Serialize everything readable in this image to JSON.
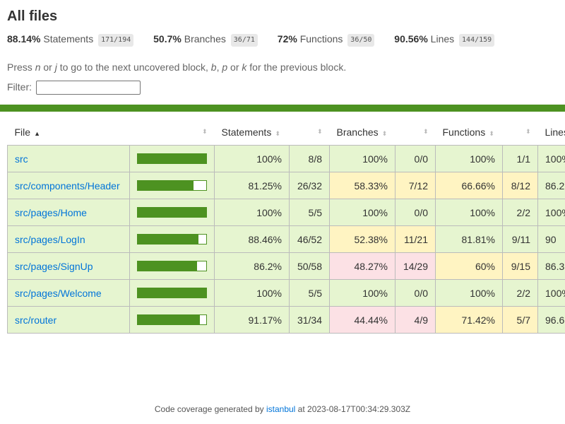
{
  "page": {
    "title": "All files",
    "instructions": {
      "prefix": "Press ",
      "key1": "n",
      "or1": " or ",
      "key2": "j",
      "mid": " to go to the next uncovered block, ",
      "key3": "b",
      "comma": ", ",
      "key4": "p",
      "or2": " or ",
      "key5": "k",
      "suffix": " for the previous block."
    },
    "filter_label": "Filter:",
    "filter_value": ""
  },
  "summary": {
    "statements": {
      "pct": "88.14%",
      "label": "Statements",
      "fraction": "171/194"
    },
    "branches": {
      "pct": "50.7%",
      "label": "Branches",
      "fraction": "36/71"
    },
    "functions": {
      "pct": "72%",
      "label": "Functions",
      "fraction": "36/50"
    },
    "lines": {
      "pct": "90.56%",
      "label": "Lines",
      "fraction": "144/159"
    }
  },
  "table": {
    "headers": {
      "file": "File",
      "statements": "Statements",
      "branches": "Branches",
      "functions": "Functions",
      "lines": "Lines"
    },
    "rows": [
      {
        "file": "src",
        "bar": 1.0,
        "st_pct": "100%",
        "st_frac": "8/8",
        "st_class": "high",
        "br_pct": "100%",
        "br_frac": "0/0",
        "br_class": "high",
        "fn_pct": "100%",
        "fn_frac": "1/1",
        "fn_class": "high",
        "ln_pct": "100%",
        "ln_class": "high"
      },
      {
        "file": "src/components/Header",
        "bar": 0.8125,
        "st_pct": "81.25%",
        "st_frac": "26/32",
        "st_class": "high",
        "br_pct": "58.33%",
        "br_frac": "7/12",
        "br_class": "medium",
        "fn_pct": "66.66%",
        "fn_frac": "8/12",
        "fn_class": "medium",
        "ln_pct": "86.2",
        "ln_class": "high"
      },
      {
        "file": "src/pages/Home",
        "bar": 1.0,
        "st_pct": "100%",
        "st_frac": "5/5",
        "st_class": "high",
        "br_pct": "100%",
        "br_frac": "0/0",
        "br_class": "high",
        "fn_pct": "100%",
        "fn_frac": "2/2",
        "fn_class": "high",
        "ln_pct": "100%",
        "ln_class": "high"
      },
      {
        "file": "src/pages/LogIn",
        "bar": 0.8846,
        "st_pct": "88.46%",
        "st_frac": "46/52",
        "st_class": "high",
        "br_pct": "52.38%",
        "br_frac": "11/21",
        "br_class": "medium",
        "fn_pct": "81.81%",
        "fn_frac": "9/11",
        "fn_class": "high",
        "ln_pct": "90",
        "ln_class": "high"
      },
      {
        "file": "src/pages/SignUp",
        "bar": 0.862,
        "st_pct": "86.2%",
        "st_frac": "50/58",
        "st_class": "high",
        "br_pct": "48.27%",
        "br_frac": "14/29",
        "br_class": "low",
        "fn_pct": "60%",
        "fn_frac": "9/15",
        "fn_class": "medium",
        "ln_pct": "86.3",
        "ln_class": "high"
      },
      {
        "file": "src/pages/Welcome",
        "bar": 1.0,
        "st_pct": "100%",
        "st_frac": "5/5",
        "st_class": "high",
        "br_pct": "100%",
        "br_frac": "0/0",
        "br_class": "high",
        "fn_pct": "100%",
        "fn_frac": "2/2",
        "fn_class": "high",
        "ln_pct": "100%",
        "ln_class": "high"
      },
      {
        "file": "src/router",
        "bar": 0.9117,
        "st_pct": "91.17%",
        "st_frac": "31/34",
        "st_class": "high",
        "br_pct": "44.44%",
        "br_frac": "4/9",
        "br_class": "low",
        "fn_pct": "71.42%",
        "fn_frac": "5/7",
        "fn_class": "medium",
        "ln_pct": "96.6",
        "ln_class": "high"
      }
    ]
  },
  "footer": {
    "prefix": "Code coverage generated by ",
    "link": "istanbul",
    "suffix": " at 2023-08-17T00:34:29.303Z"
  },
  "colors": {
    "high": "#e6f5d0",
    "medium": "#fff4c2",
    "low": "#fce1e5",
    "status_bar": "#4d9221",
    "link": "#0074d9"
  },
  "icons": {
    "sort_active": "sort-up-icon",
    "sort_inactive": "sort-icon"
  }
}
